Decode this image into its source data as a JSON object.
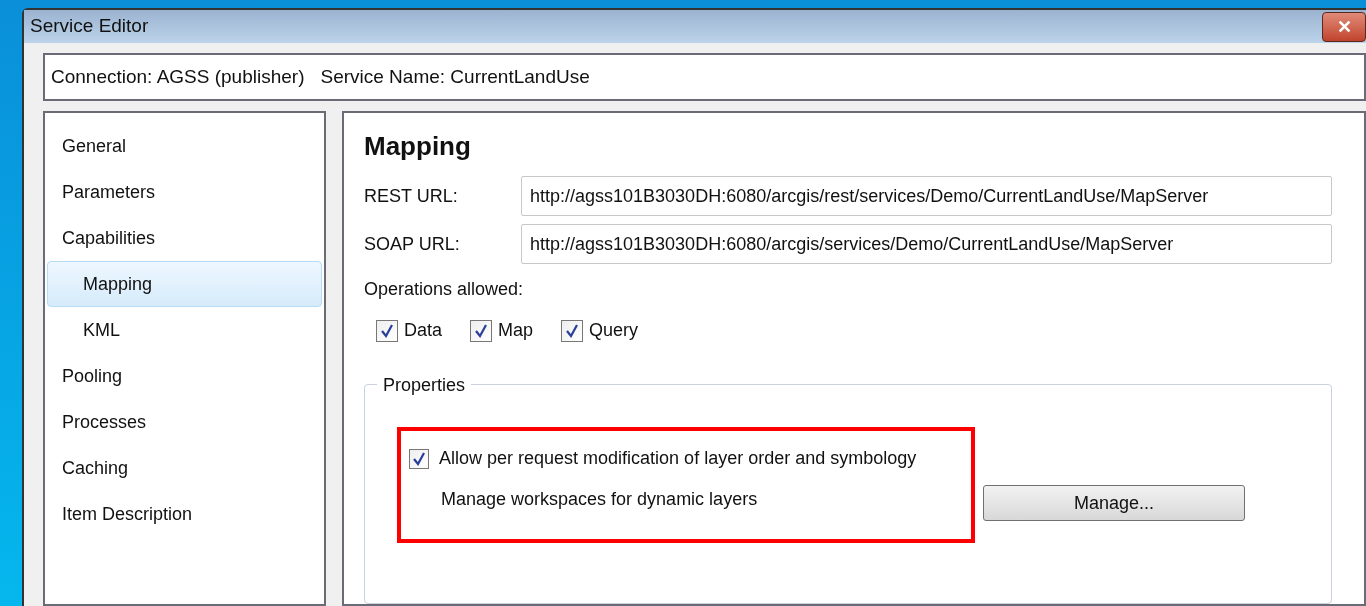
{
  "window": {
    "title": "Service Editor",
    "close_label": "✕"
  },
  "header": {
    "connection": "Connection: AGSS (publisher)",
    "service_name": "Service Name: CurrentLandUse"
  },
  "sidebar": {
    "items": [
      {
        "label": "General",
        "selected": false
      },
      {
        "label": "Parameters",
        "selected": false
      },
      {
        "label": "Capabilities",
        "selected": false,
        "children": [
          {
            "label": "Mapping",
            "selected": true
          },
          {
            "label": "KML",
            "selected": false
          }
        ]
      },
      {
        "label": "Pooling",
        "selected": false
      },
      {
        "label": "Processes",
        "selected": false
      },
      {
        "label": "Caching",
        "selected": false
      },
      {
        "label": "Item Description",
        "selected": false
      }
    ]
  },
  "content": {
    "heading": "Mapping",
    "fields": [
      {
        "label": "REST URL:",
        "value": "http://agss101B3030DH:6080/arcgis/rest/services/Demo/CurrentLandUse/MapServer"
      },
      {
        "label": "SOAP URL:",
        "value": "http://agss101B3030DH:6080/arcgis/services/Demo/CurrentLandUse/MapServer"
      }
    ],
    "operations_label": "Operations allowed:",
    "operations": [
      {
        "label": "Data",
        "checked": true
      },
      {
        "label": "Map",
        "checked": true
      },
      {
        "label": "Query",
        "checked": true
      }
    ],
    "properties": {
      "legend": "Properties",
      "option": {
        "label": "Allow per request modification of layer order and symbology",
        "checked": true
      },
      "manage_text": "Manage workspaces for dynamic layers",
      "manage_button": "Manage..."
    }
  }
}
